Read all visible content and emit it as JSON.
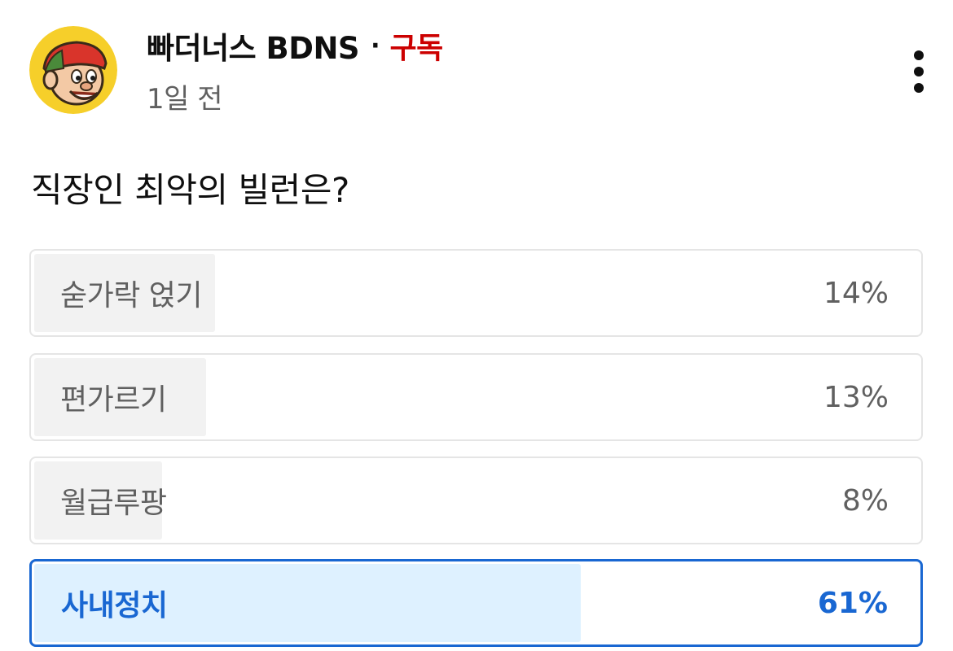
{
  "post": {
    "channel_name": "빠더너스 BDNS",
    "separator": "·",
    "subscribe_label": "구독",
    "time_ago": "1일 전",
    "question": "직장인 최악의 빌런은?"
  },
  "poll": {
    "options": [
      {
        "label": "숟가락 얹기",
        "percent_text": "14%",
        "percent": 14,
        "selected": false
      },
      {
        "label": "편가르기",
        "percent_text": "13%",
        "percent": 13,
        "selected": false
      },
      {
        "label": "월급루팡",
        "percent_text": "8%",
        "percent": 8,
        "selected": false
      },
      {
        "label": "사내정치",
        "percent_text": "61%",
        "percent": 61,
        "selected": true
      }
    ]
  },
  "colors": {
    "subscribe": "#cc0000",
    "selected_accent": "#1967d2",
    "selected_fill": "#def1ff",
    "unselected_fill": "#f2f2f2"
  },
  "icons": {
    "avatar": "cartoon-boy-avatar",
    "menu": "more-vertical-icon"
  }
}
